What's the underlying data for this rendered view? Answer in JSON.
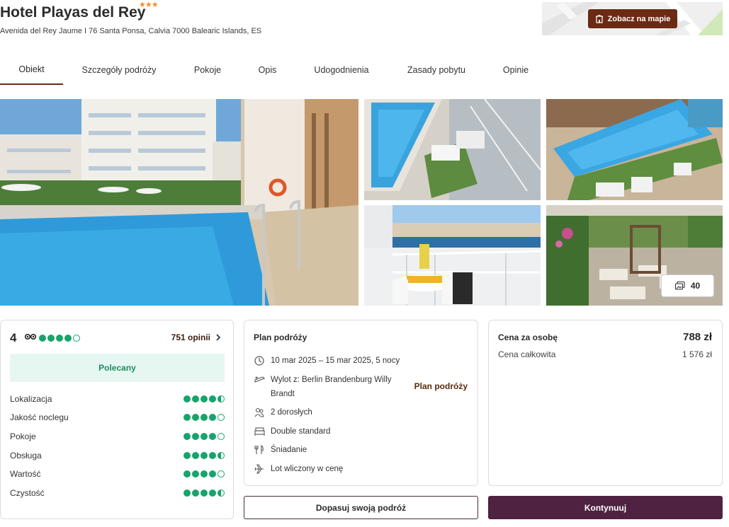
{
  "hotel": {
    "name": "Hotel Playas del Rey",
    "stars": "★★★",
    "address": "Avenida del Rey Jaume I 76 Santa Ponsa, Calvia 7000 Balearic Islands, ES"
  },
  "map": {
    "button_label": "Zobacz na mapie"
  },
  "tabs": [
    {
      "label": "Obiekt"
    },
    {
      "label": "Szczegóły podróży"
    },
    {
      "label": "Pokoje"
    },
    {
      "label": "Opis"
    },
    {
      "label": "Udogodnienia"
    },
    {
      "label": "Zasady pobytu"
    },
    {
      "label": "Opinie"
    }
  ],
  "gallery": {
    "photo_count": "40"
  },
  "rating": {
    "score": "4",
    "reviews_label": "751 opinii",
    "recommended_label": "Polecany",
    "criteria": [
      {
        "label": "Lokalizacja"
      },
      {
        "label": "Jakość noclegu"
      },
      {
        "label": "Pokoje"
      },
      {
        "label": "Obsługa"
      },
      {
        "label": "Wartość"
      },
      {
        "label": "Czystość"
      }
    ]
  },
  "plan": {
    "title": "Plan podróży",
    "link_label": "Plan podróży",
    "dates": "10 mar 2025 – 15 mar 2025, 5 nocy",
    "departure_line1": "Wylot z: Berlin Brandenburg Willy",
    "departure_line2": "Brandt",
    "guests": "2 dorosłych",
    "room": "Double standard",
    "board": "Śniadanie",
    "flight": "Lot wliczony w cenę"
  },
  "price": {
    "per_person_label": "Cena za osobę",
    "per_person_value": "788 zł",
    "total_label": "Cena całkowita",
    "total_value": "1 576 zł"
  },
  "actions": {
    "customize_label": "Dopasuj swoją podróż",
    "continue_label": "Kontynuuj"
  },
  "colors": {
    "brand_brown": "#6b2a13",
    "primary_button": "#4e2240",
    "rating_green": "#16a46b",
    "recommended_bg": "#e6f7f1"
  }
}
